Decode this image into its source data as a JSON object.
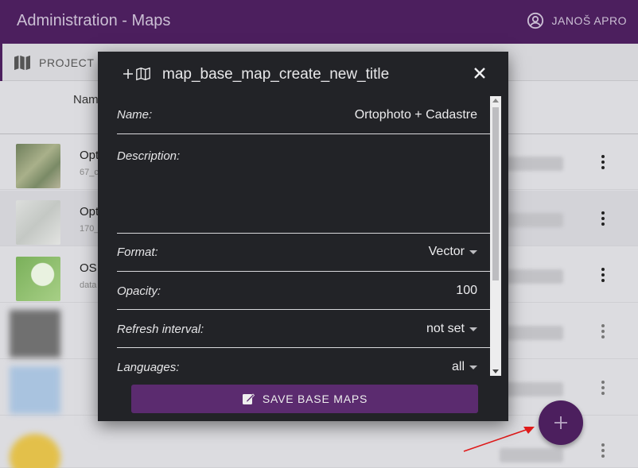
{
  "appbar": {
    "title": "Administration - Maps",
    "user_name": "JANOŠ APRO",
    "user_icon": "account-circle-icon"
  },
  "tabs": [
    {
      "label": "PROJECT",
      "icon": "map-icon"
    }
  ],
  "table": {
    "column_header": "Nam",
    "rows": [
      {
        "name": "Opt",
        "sub": "67_c",
        "thumb_color": "#8a9a78"
      },
      {
        "name": "Opt",
        "sub": "170_",
        "thumb_color": "#d2d4d2"
      },
      {
        "name": "OSI",
        "sub": "data",
        "thumb_color": "#7ab05a"
      },
      {
        "name": "",
        "sub": "",
        "thumb_color": "#6e6e6e"
      },
      {
        "name": "",
        "sub": "",
        "thumb_color": "#9bb6d9"
      },
      {
        "name": "",
        "sub": "",
        "thumb_color": "#e8c23a"
      }
    ]
  },
  "dialog": {
    "title": "map_base_map_create_new_title",
    "fields": {
      "name": {
        "label": "Name:",
        "value": "Ortophoto + Cadastre"
      },
      "description": {
        "label": "Description:",
        "value": ""
      },
      "format": {
        "label": "Format:",
        "value": "Vector"
      },
      "opacity": {
        "label": "Opacity:",
        "value": "100"
      },
      "refresh_interval": {
        "label": "Refresh interval:",
        "value": "not set"
      },
      "languages": {
        "label": "Languages:",
        "value": "all"
      }
    },
    "save_button": "SAVE BASE MAPS"
  },
  "fab": {
    "icon": "plus-icon"
  },
  "colors": {
    "brand": "#4c1f5e",
    "dialog_bg": "#222327",
    "button": "#5b2b6f",
    "annotation_arrow": "#e01a1a"
  }
}
